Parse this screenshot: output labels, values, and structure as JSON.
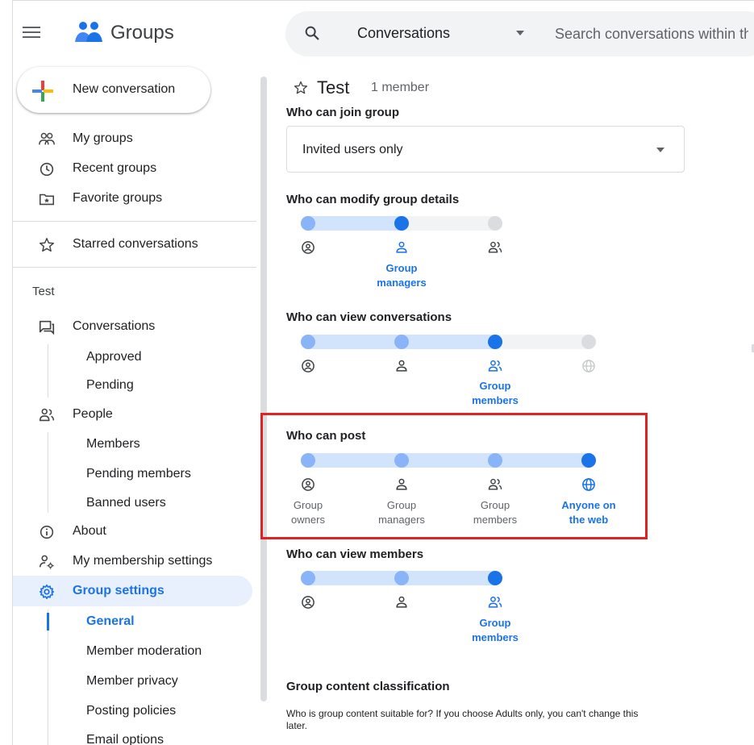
{
  "header": {
    "app_title": "Groups",
    "search_scope": "Conversations",
    "search_placeholder": "Search conversations within this group"
  },
  "sidebar": {
    "new_conversation": "New conversation",
    "top_items": [
      {
        "label": "My groups",
        "icon": "groups-icon"
      },
      {
        "label": "Recent groups",
        "icon": "clock-icon"
      },
      {
        "label": "Favorite groups",
        "icon": "folder-star-icon"
      }
    ],
    "starred": "Starred conversations",
    "group_name": "Test",
    "conversations": {
      "label": "Conversations",
      "subitems": [
        "Approved",
        "Pending"
      ]
    },
    "people": {
      "label": "People",
      "subitems": [
        "Members",
        "Pending members",
        "Banned users"
      ]
    },
    "about": "About",
    "membership": "My membership settings",
    "group_settings": {
      "label": "Group settings",
      "subitems": [
        "General",
        "Member moderation",
        "Member privacy",
        "Posting policies",
        "Email options"
      ]
    }
  },
  "main": {
    "title": "Test",
    "member_count": "1 member",
    "clipped_label": "Who can join group",
    "join_select_value": "Invited users only",
    "modify": {
      "title": "Who can modify group details",
      "selected_label": [
        "Group",
        "managers"
      ]
    },
    "view_conversations": {
      "title": "Who can view conversations",
      "selected_label": [
        "Group",
        "members"
      ]
    },
    "post": {
      "title": "Who can post",
      "labels": [
        [
          "Group",
          "owners"
        ],
        [
          "Group",
          "managers"
        ],
        [
          "Group",
          "members"
        ],
        [
          "Anyone on",
          "the web"
        ]
      ]
    },
    "view_members": {
      "title": "Who can view members",
      "selected_label": [
        "Group",
        "members"
      ]
    },
    "classification_title": "Group content classification",
    "classification_desc": "Who is group content suitable for? If you choose Adults only, you can't change this later."
  },
  "colors": {
    "accent": "#1a73e8",
    "track_active": "#d2e3fc",
    "track_inactive": "#f1f3f4",
    "dot_active": "#8ab4f8",
    "dot_inactive": "#dadce0",
    "highlight": "#e32022"
  }
}
